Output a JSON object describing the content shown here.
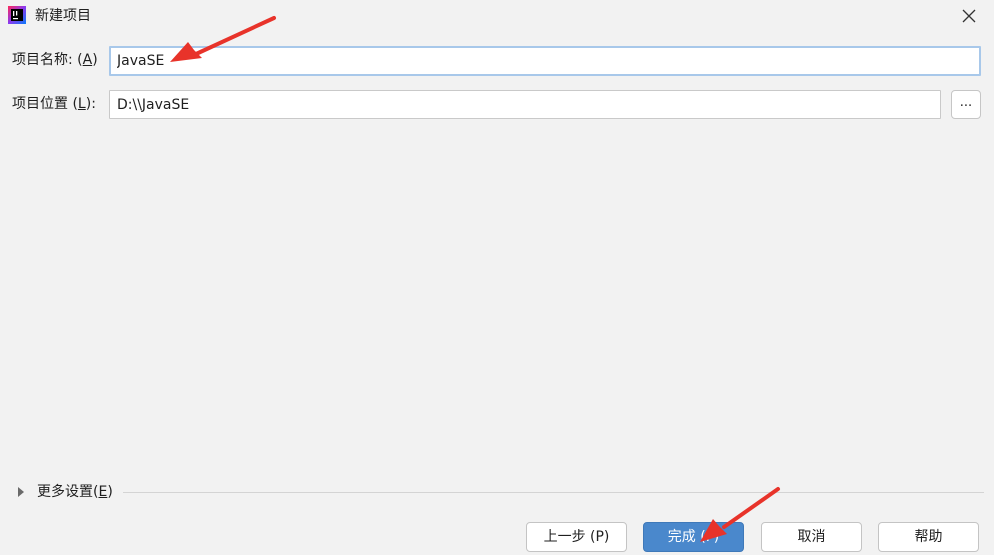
{
  "window": {
    "title": "新建项目",
    "app_icon": "intellij-idea-icon",
    "close_icon": "close-icon"
  },
  "form": {
    "name_label_prefix": "项目名称: (",
    "name_label_mnemonic": "A",
    "name_label_suffix": ")",
    "name_value": "JavaSE",
    "location_label_prefix": "项目位置 (",
    "location_label_mnemonic": "L",
    "location_label_suffix": "):",
    "location_value": "D:\\\\JavaSE",
    "browse_label": "..."
  },
  "more_settings": {
    "label_prefix": "更多设置(",
    "label_mnemonic": "E",
    "label_suffix": ")",
    "expand_icon": "triangle-right-icon"
  },
  "buttons": {
    "previous": "上一步 (P)",
    "finish": "完成 (F)",
    "cancel": "取消",
    "help": "帮助"
  },
  "annotations": {
    "arrow_color": "#e8332a"
  },
  "colors": {
    "focus_border": "#a8c8ea",
    "primary_button": "#4a88cc"
  }
}
